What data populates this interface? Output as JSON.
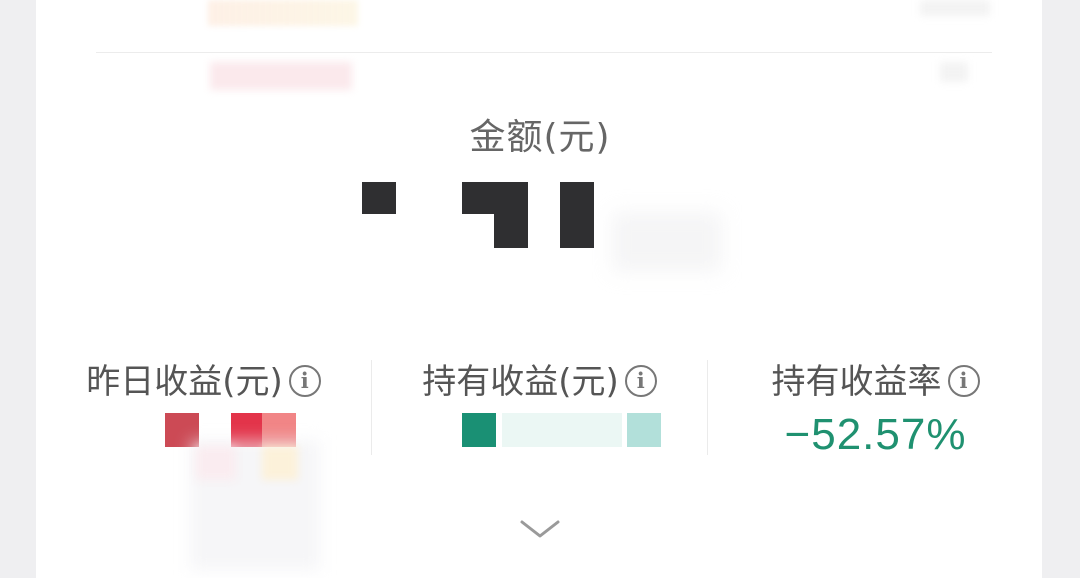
{
  "summary": {
    "amount_label": "金额(元)",
    "amount_value_masked_icon": "pixelated-amount"
  },
  "stats": [
    {
      "label": "昨日收益(元)",
      "info_icon": "info-icon",
      "value_masked_icon": "pixelated-value",
      "color": "#d93344"
    },
    {
      "label": "持有收益(元)",
      "info_icon": "info-icon",
      "value_masked_icon": "pixelated-value",
      "color": "#1a9074"
    },
    {
      "label": "持有收益率",
      "info_icon": "info-icon",
      "value": "−52.57%",
      "color": "#1f9170"
    }
  ],
  "info_glyph": "i",
  "expand_icon": "chevron-down-icon"
}
